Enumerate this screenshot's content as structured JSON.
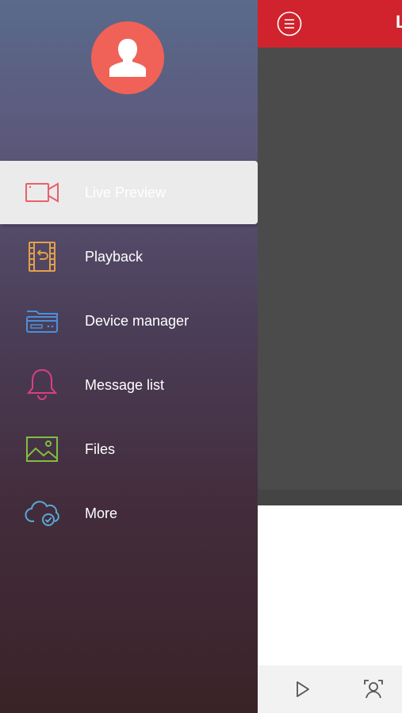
{
  "drawer": {
    "avatar_icon": "user-silhouette-icon",
    "items": [
      {
        "label": "Live Preview",
        "icon": "video-camera-icon",
        "active": true
      },
      {
        "label": "Playback",
        "icon": "film-playback-icon",
        "active": false
      },
      {
        "label": "Device manager",
        "icon": "dvr-device-icon",
        "active": false
      },
      {
        "label": "Message list",
        "icon": "bell-icon",
        "active": false
      },
      {
        "label": "Files",
        "icon": "image-icon",
        "active": false
      },
      {
        "label": "More",
        "icon": "cloud-check-icon",
        "active": false
      }
    ]
  },
  "main": {
    "title": "L",
    "menu_icon": "hamburger-circle-icon",
    "bottom_icons": [
      "play-icon",
      "face-scan-icon"
    ]
  },
  "colors": {
    "accent": "#d0232d",
    "avatar": "#f06257",
    "live_icon": "#e8606a",
    "playback_icon": "#e3a04a",
    "device_icon": "#4a8fd8",
    "message_icon": "#d9407f",
    "files_icon": "#7fbf3f",
    "more_icon": "#5aa9d8"
  }
}
